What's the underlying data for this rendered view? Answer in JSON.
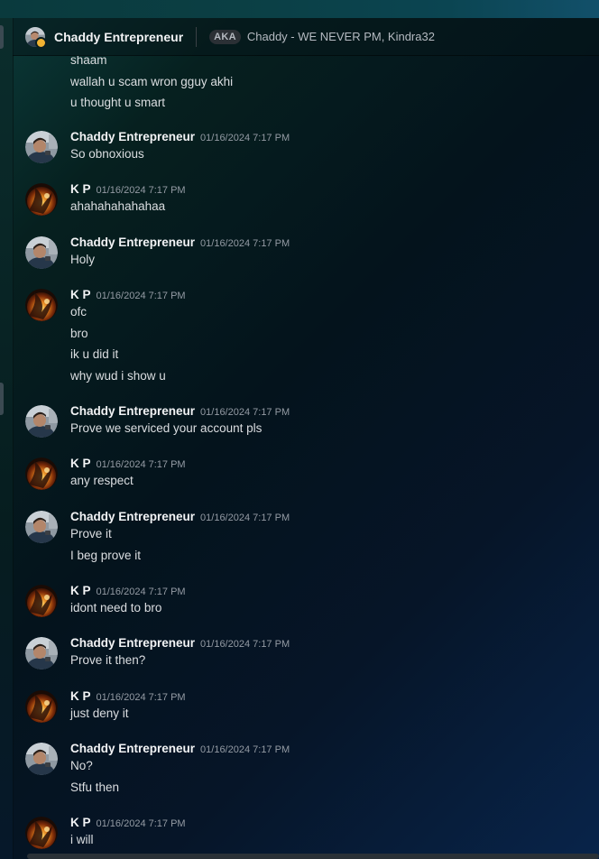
{
  "header": {
    "name": "Chaddy Entrepreneur",
    "aka_badge": "AKA",
    "aka_names": "Chaddy - WE NEVER PM, Kindra32"
  },
  "continuation": [
    "shaam",
    "wallah u scam wron gguy akhi",
    "u thought u smart"
  ],
  "messages": [
    {
      "author": "Chaddy Entrepreneur",
      "avatar": "chaddy",
      "ts": "01/16/2024 7:17 PM",
      "lines": [
        "So obnoxious"
      ]
    },
    {
      "author": "K P",
      "avatar": "kp",
      "ts": "01/16/2024 7:17 PM",
      "lines": [
        "ahahahahahahaa"
      ]
    },
    {
      "author": "Chaddy Entrepreneur",
      "avatar": "chaddy",
      "ts": "01/16/2024 7:17 PM",
      "lines": [
        "Holy"
      ]
    },
    {
      "author": "K P",
      "avatar": "kp",
      "ts": "01/16/2024 7:17 PM",
      "lines": [
        "ofc",
        "bro",
        "ik u did it",
        "why wud i show u"
      ]
    },
    {
      "author": "Chaddy Entrepreneur",
      "avatar": "chaddy",
      "ts": "01/16/2024 7:17 PM",
      "lines": [
        "Prove we serviced your account pls"
      ]
    },
    {
      "author": "K P",
      "avatar": "kp",
      "ts": "01/16/2024 7:17 PM",
      "lines": [
        "any respect"
      ]
    },
    {
      "author": "Chaddy Entrepreneur",
      "avatar": "chaddy",
      "ts": "01/16/2024 7:17 PM",
      "lines": [
        "Prove it",
        "I beg prove it"
      ]
    },
    {
      "author": "K P",
      "avatar": "kp",
      "ts": "01/16/2024 7:17 PM",
      "lines": [
        "idont need to bro"
      ]
    },
    {
      "author": "Chaddy Entrepreneur",
      "avatar": "chaddy",
      "ts": "01/16/2024 7:17 PM",
      "lines": [
        "Prove it then?"
      ]
    },
    {
      "author": "K P",
      "avatar": "kp",
      "ts": "01/16/2024 7:17 PM",
      "lines": [
        "just deny it"
      ]
    },
    {
      "author": "Chaddy Entrepreneur",
      "avatar": "chaddy",
      "ts": "01/16/2024 7:17 PM",
      "lines": [
        "No?",
        "Stfu then"
      ]
    },
    {
      "author": "K P",
      "avatar": "kp",
      "ts": "01/16/2024 7:17 PM",
      "lines": [
        "i will"
      ]
    }
  ]
}
